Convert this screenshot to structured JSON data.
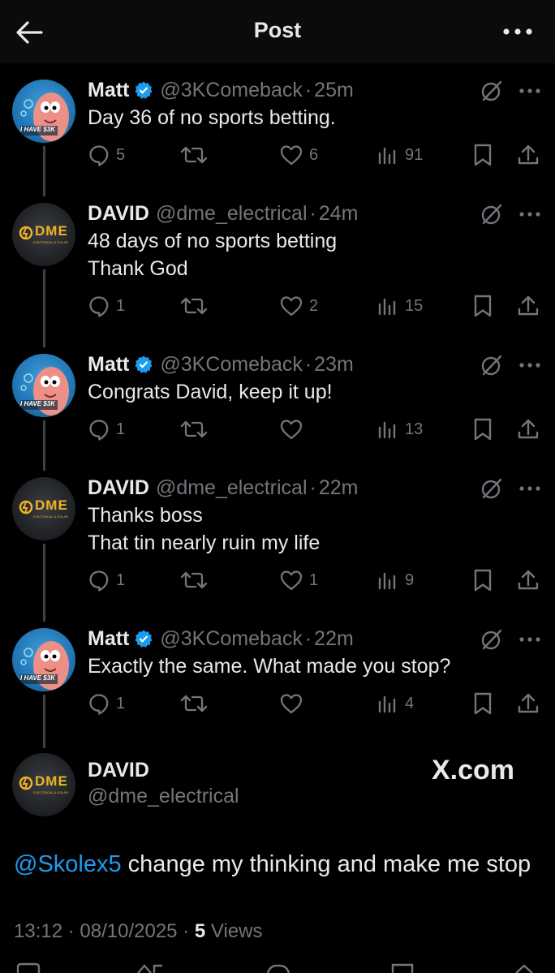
{
  "header": {
    "title": "Post",
    "back_icon": "arrow-left-icon",
    "more_icon": "more-horizontal-icon"
  },
  "colors": {
    "background": "#000000",
    "text": "#e7e9ea",
    "secondary": "#71767b",
    "link": "#1d9bf0",
    "verified": "#1d9bf0"
  },
  "tweets": [
    {
      "name": "Matt",
      "verified": true,
      "handle": "@3KComeback",
      "time": "25m",
      "lines": [
        "Day 36 of no sports betting."
      ],
      "replies": "5",
      "reposts": "",
      "likes": "6",
      "views": "91"
    },
    {
      "name": "DAVID",
      "verified": false,
      "handle": "@dme_electrical",
      "time": "24m",
      "lines": [
        "48 days of no sports betting",
        "Thank God"
      ],
      "replies": "1",
      "reposts": "",
      "likes": "2",
      "views": "15"
    },
    {
      "name": "Matt",
      "verified": true,
      "handle": "@3KComeback",
      "time": "23m",
      "lines": [
        "Congrats David, keep it up!"
      ],
      "replies": "1",
      "reposts": "",
      "likes": "",
      "views": "13"
    },
    {
      "name": "DAVID",
      "verified": false,
      "handle": "@dme_electrical",
      "time": "22m",
      "lines": [
        "Thanks boss",
        "That tin nearly ruin my life"
      ],
      "replies": "1",
      "reposts": "",
      "likes": "1",
      "views": "9"
    },
    {
      "name": "Matt",
      "verified": true,
      "handle": "@3KComeback",
      "time": "22m",
      "lines": [
        "Exactly the same. What made you stop?"
      ],
      "replies": "1",
      "reposts": "",
      "likes": "",
      "views": "4"
    }
  ],
  "main_post": {
    "name": "DAVID",
    "handle": "@dme_electrical",
    "mention": "@Skolex5",
    "text": " change my thinking and make me stop",
    "time": "13:12",
    "date": "08/10/2025",
    "views_count": "5",
    "views_label": "Views",
    "watermark": "X.com"
  },
  "avatars": {
    "matt_caption": "I HAVE $3K",
    "dme_logo": "DME",
    "dme_sub": "ELECTRICAL & SOLAR"
  }
}
